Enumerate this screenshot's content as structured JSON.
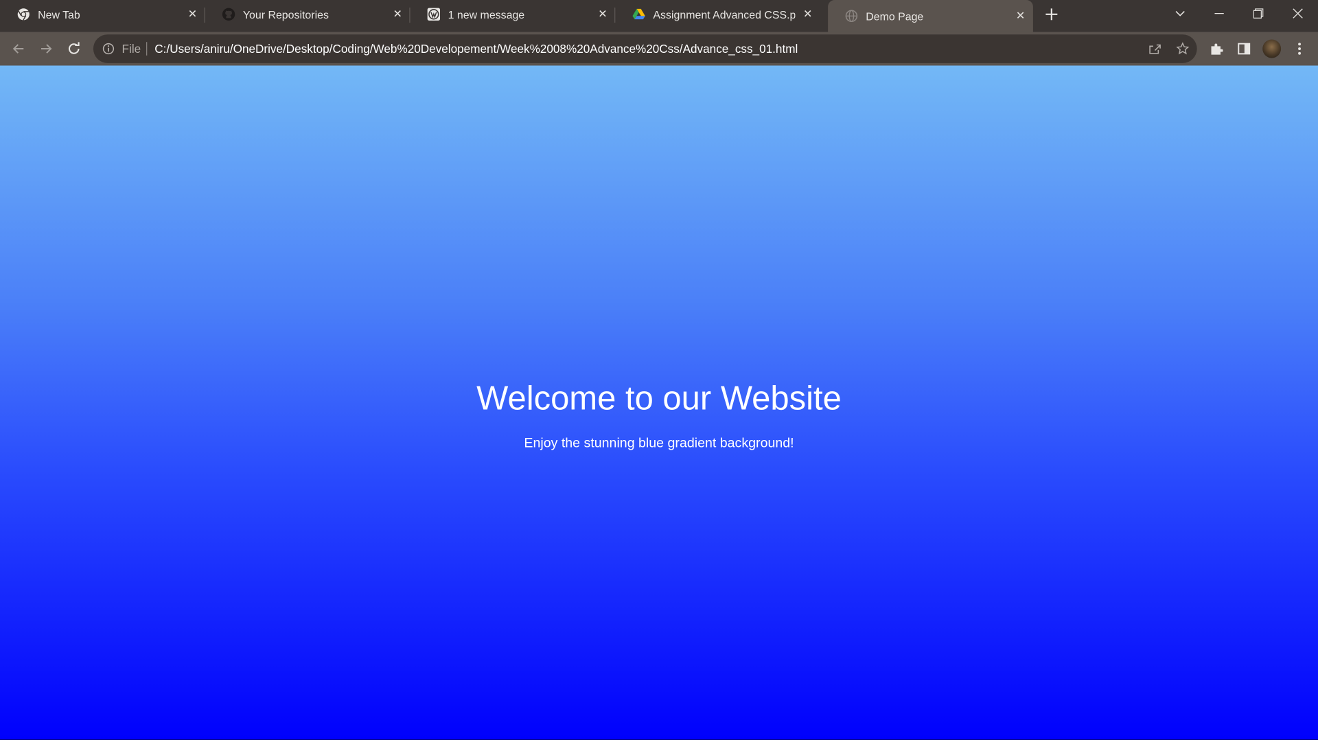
{
  "tabs": [
    {
      "title": "New Tab",
      "icon": "chrome-icon"
    },
    {
      "title": "Your Repositories",
      "icon": "github-icon"
    },
    {
      "title": "1 new message",
      "icon": "wordpress-icon"
    },
    {
      "title": "Assignment Advanced CSS.pdf -",
      "icon": "google-drive-icon"
    },
    {
      "title": "Demo Page",
      "icon": "globe-icon"
    }
  ],
  "address_bar": {
    "scheme_label": "File",
    "url": "C:/Users/aniru/OneDrive/Desktop/Coding/Web%20Developement/Week%2008%20Advance%20Css/Advance_css_01.html"
  },
  "page": {
    "heading": "Welcome to our Website",
    "subtext": "Enjoy the stunning blue gradient background!"
  },
  "colors": {
    "tab_strip": "#3a3533",
    "toolbar": "#5a534e",
    "gradient_top": "#73b8f6",
    "gradient_bottom": "#0000fd"
  }
}
